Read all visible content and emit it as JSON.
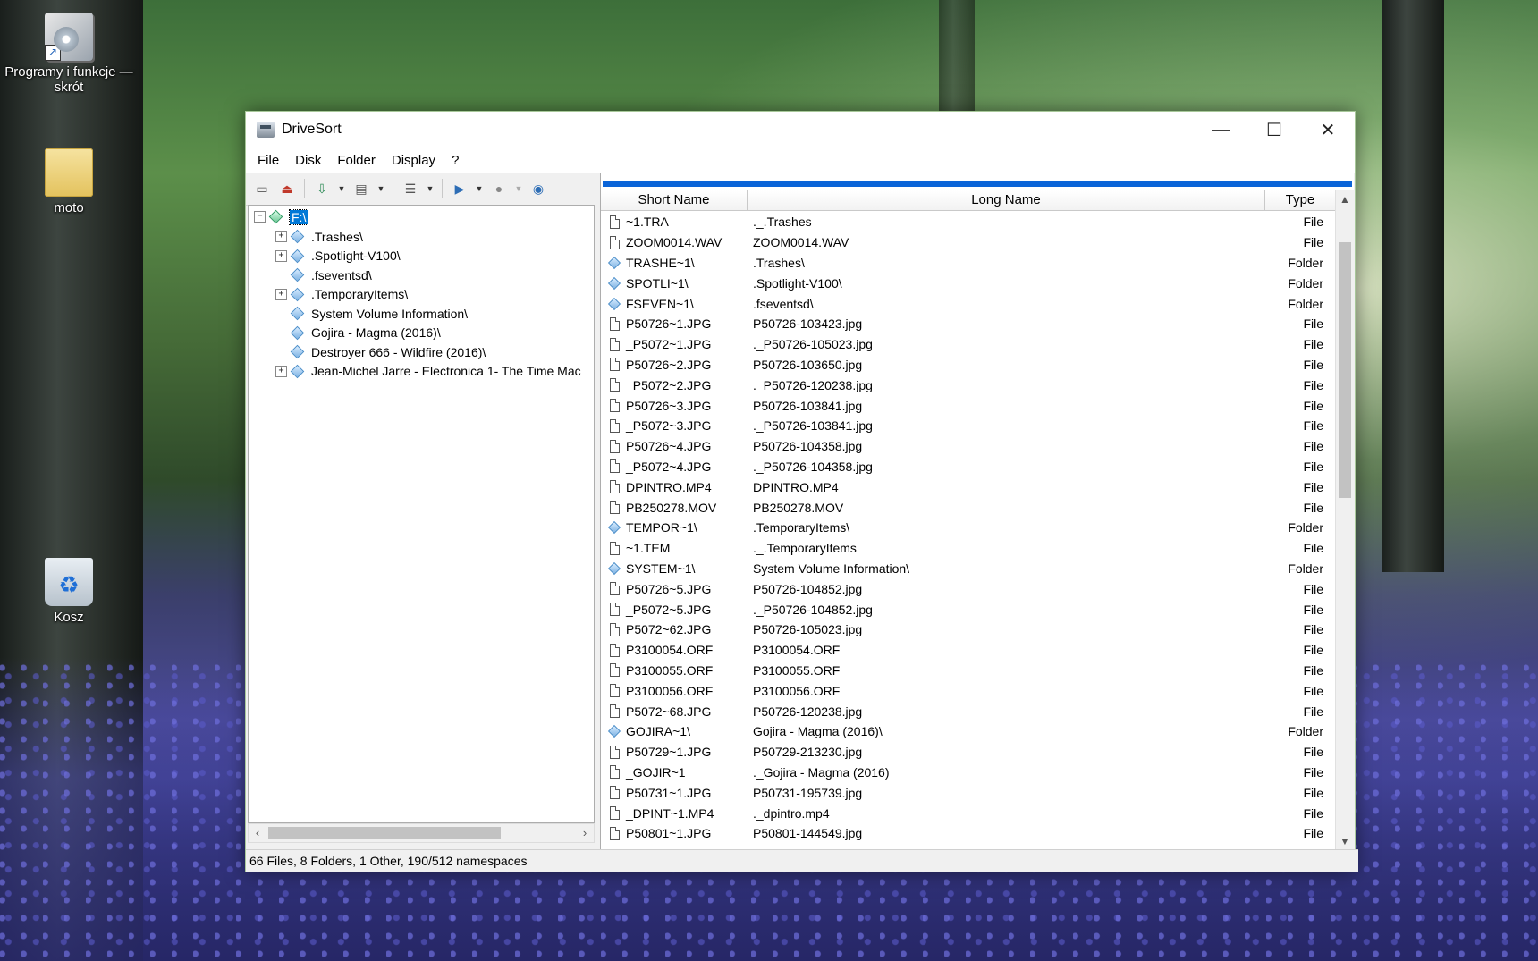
{
  "desktop": {
    "icons": [
      {
        "label": "Programy i funkcje — skrót",
        "icon": "programs-shortcut-icon"
      },
      {
        "label": "moto",
        "icon": "folder-icon"
      },
      {
        "label": "Kosz",
        "icon": "recycle-bin-icon"
      }
    ]
  },
  "window": {
    "title": "DriveSort",
    "controls": {
      "minimize": "—",
      "maximize": "☐",
      "close": "✕"
    },
    "menu": [
      "File",
      "Disk",
      "Folder",
      "Display",
      "?"
    ]
  },
  "toolbar": {
    "buttons": [
      "drive-icon",
      "eject-icon",
      "sort-icon",
      "write-icon",
      "list-view-icon",
      "play-icon",
      "record-icon",
      "stop-icon"
    ]
  },
  "tree": {
    "root": "F:\\",
    "items": [
      {
        "label": ".Trashes\\",
        "expandable": true
      },
      {
        "label": ".Spotlight-V100\\",
        "expandable": true
      },
      {
        "label": ".fseventsd\\",
        "expandable": false
      },
      {
        "label": ".TemporaryItems\\",
        "expandable": true
      },
      {
        "label": "System Volume Information\\",
        "expandable": false
      },
      {
        "label": "Gojira - Magma (2016)\\",
        "expandable": false
      },
      {
        "label": "Destroyer 666 - Wildfire (2016)\\",
        "expandable": false
      },
      {
        "label": "Jean-Michel Jarre - Electronica 1- The Time Mac",
        "expandable": true
      }
    ],
    "expander_plus": "+",
    "expander_minus": "−"
  },
  "list": {
    "progress": 1.0,
    "columns": {
      "short": "Short Name",
      "long": "Long Name",
      "type": "Type"
    },
    "rows": [
      {
        "short": "~1.TRA",
        "long": "._.Trashes",
        "type": "File"
      },
      {
        "short": "ZOOM0014.WAV",
        "long": "ZOOM0014.WAV",
        "type": "File"
      },
      {
        "short": "TRASHE~1\\",
        "long": ".Trashes\\",
        "type": "Folder"
      },
      {
        "short": "SPOTLI~1\\",
        "long": ".Spotlight-V100\\",
        "type": "Folder"
      },
      {
        "short": "FSEVEN~1\\",
        "long": ".fseventsd\\",
        "type": "Folder"
      },
      {
        "short": "P50726~1.JPG",
        "long": "P50726-103423.jpg",
        "type": "File"
      },
      {
        "short": "_P5072~1.JPG",
        "long": "._P50726-105023.jpg",
        "type": "File"
      },
      {
        "short": "P50726~2.JPG",
        "long": "P50726-103650.jpg",
        "type": "File"
      },
      {
        "short": "_P5072~2.JPG",
        "long": "._P50726-120238.jpg",
        "type": "File"
      },
      {
        "short": "P50726~3.JPG",
        "long": "P50726-103841.jpg",
        "type": "File"
      },
      {
        "short": "_P5072~3.JPG",
        "long": "._P50726-103841.jpg",
        "type": "File"
      },
      {
        "short": "P50726~4.JPG",
        "long": "P50726-104358.jpg",
        "type": "File"
      },
      {
        "short": "_P5072~4.JPG",
        "long": "._P50726-104358.jpg",
        "type": "File"
      },
      {
        "short": "DPINTRO.MP4",
        "long": "DPINTRO.MP4",
        "type": "File"
      },
      {
        "short": "PB250278.MOV",
        "long": "PB250278.MOV",
        "type": "File"
      },
      {
        "short": "TEMPOR~1\\",
        "long": ".TemporaryItems\\",
        "type": "Folder"
      },
      {
        "short": "~1.TEM",
        "long": "._.TemporaryItems",
        "type": "File"
      },
      {
        "short": "SYSTEM~1\\",
        "long": "System Volume Information\\",
        "type": "Folder"
      },
      {
        "short": "P50726~5.JPG",
        "long": "P50726-104852.jpg",
        "type": "File"
      },
      {
        "short": "_P5072~5.JPG",
        "long": "._P50726-104852.jpg",
        "type": "File"
      },
      {
        "short": "P5072~62.JPG",
        "long": "P50726-105023.jpg",
        "type": "File"
      },
      {
        "short": "P3100054.ORF",
        "long": "P3100054.ORF",
        "type": "File"
      },
      {
        "short": "P3100055.ORF",
        "long": "P3100055.ORF",
        "type": "File"
      },
      {
        "short": "P3100056.ORF",
        "long": "P3100056.ORF",
        "type": "File"
      },
      {
        "short": "P5072~68.JPG",
        "long": "P50726-120238.jpg",
        "type": "File"
      },
      {
        "short": "GOJIRA~1\\",
        "long": "Gojira - Magma (2016)\\",
        "type": "Folder"
      },
      {
        "short": "P50729~1.JPG",
        "long": "P50729-213230.jpg",
        "type": "File"
      },
      {
        "short": "_GOJIR~1",
        "long": "._Gojira - Magma (2016)",
        "type": "File"
      },
      {
        "short": "P50731~1.JPG",
        "long": "P50731-195739.jpg",
        "type": "File"
      },
      {
        "short": "_DPINT~1.MP4",
        "long": "._dpintro.mp4",
        "type": "File"
      },
      {
        "short": "P50801~1.JPG",
        "long": "P50801-144549.jpg",
        "type": "File"
      }
    ]
  },
  "status": "66 Files, 8 Folders, 1 Other, 190/512 namespaces"
}
